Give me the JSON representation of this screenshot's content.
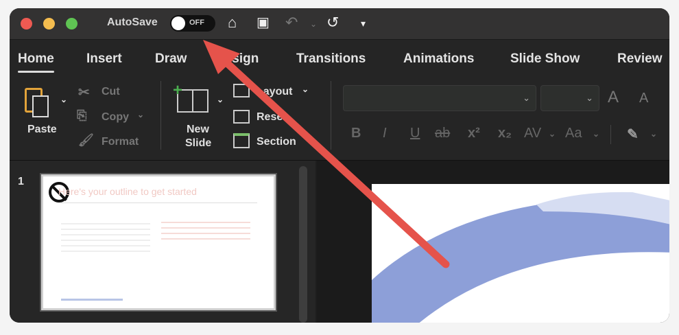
{
  "titlebar": {
    "autosave_label": "AutoSave",
    "toggle_state": "OFF"
  },
  "tabs": [
    "Home",
    "Insert",
    "Draw",
    "Design",
    "Transitions",
    "Animations",
    "Slide Show",
    "Review"
  ],
  "ribbon": {
    "paste": "Paste",
    "cut": "Cut",
    "copy": "Copy",
    "format": "Format",
    "new_slide_1": "New",
    "new_slide_2": "Slide",
    "layout": "Layout",
    "reset": "Reset",
    "section": "Section",
    "bold": "B",
    "italic": "I",
    "underline": "U",
    "strike": "ab",
    "superscript": "x²",
    "subscript": "x₂",
    "spacing": "AV",
    "case": "Aa",
    "grow": "A",
    "shrink": "A"
  },
  "slides_panel": {
    "slide_number": "1",
    "thumb_title": "Here's your outline to get started"
  },
  "colors": {
    "arrow": "#e5534b",
    "close": "#ee5a52",
    "minimize": "#f5bd4f",
    "zoom": "#5fc453",
    "shape": "#8d9fd8"
  }
}
